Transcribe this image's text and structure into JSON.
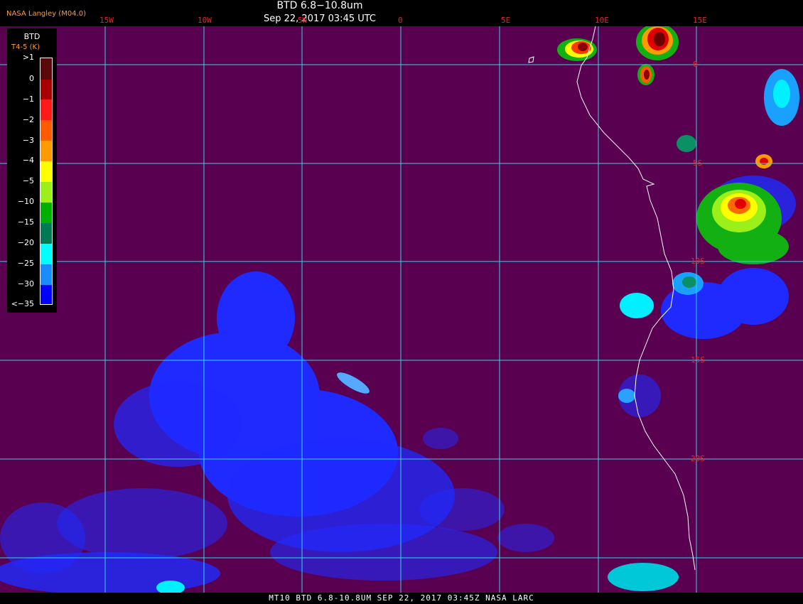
{
  "header": {
    "credit": "NASA Langley (M04.0)",
    "title": "BTD 6.8−10.8um",
    "timestamp": "Sep 22, 2017 03:45 UTC"
  },
  "footer": {
    "text": "MT10  BTD 6.8-10.8UM  SEP 22, 2017 03:45Z  NASA LARC"
  },
  "grid": {
    "longitudes": [
      "15W",
      "10W",
      "5W",
      "0",
      "5E",
      "10E",
      "15E"
    ],
    "latitudes": [
      "0",
      "5S",
      "10S",
      "15S",
      "20S"
    ],
    "longitude_values": [
      -15,
      -10,
      -5,
      0,
      5,
      10,
      15
    ],
    "latitude_values": [
      0,
      -5,
      -10,
      -15,
      -20
    ]
  },
  "legend": {
    "title": "BTD",
    "subtitle": "T4-5 (K)",
    "labels": [
      ">1",
      "0",
      "−1",
      "−2",
      "−3",
      "−4",
      "−5",
      "−10",
      "−15",
      "−20",
      "−25",
      "−30",
      "<−35"
    ],
    "colors": [
      "#5a0a0a",
      "#a80000",
      "#ff1a1a",
      "#ff5a00",
      "#ff9a00",
      "#ffff00",
      "#9cf01a",
      "#00b000",
      "#007a55",
      "#00ffff",
      "#1a8cff",
      "#0000ff",
      "#5a005a"
    ]
  },
  "colors": {
    "background": "#5a0050",
    "grid_line": "#33d6e6",
    "coastline": "#ffffff",
    "label_red": "#e0282e"
  }
}
